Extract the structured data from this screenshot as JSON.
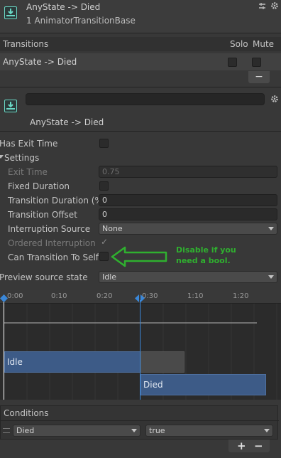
{
  "header": {
    "title": "AnyState -> Died",
    "subtitle": "1 AnimatorTransitionBase"
  },
  "transitions": {
    "heading": "Transitions",
    "solo_label": "Solo",
    "mute_label": "Mute",
    "row_label": "AnyState -> Died",
    "remove_label": "−"
  },
  "transition_inspector": {
    "name_field": "",
    "title": "AnyState -> Died",
    "has_exit_time_label": "Has Exit Time",
    "settings_label": "Settings",
    "exit_time_label": "Exit Time",
    "exit_time_value": "0.75",
    "fixed_duration_label": "Fixed Duration",
    "transition_duration_label": "Transition Duration (%)",
    "transition_duration_value": "0",
    "transition_offset_label": "Transition Offset",
    "transition_offset_value": "0",
    "interruption_source_label": "Interruption Source",
    "interruption_source_value": "None",
    "ordered_interruption_label": "Ordered Interruption",
    "ordered_interruption_check": "✓",
    "can_transition_label": "Can Transition To Self",
    "annotation_line1": "Disable if you",
    "annotation_line2": "need a bool.",
    "preview_label": "Preview source state",
    "preview_value": "Idle"
  },
  "timeline": {
    "ticks": [
      "0:00",
      "0:10",
      "0:20",
      "0:30",
      "1:10",
      "1:20"
    ],
    "bar_idle": "Idle",
    "bar_died": "Died"
  },
  "conditions": {
    "heading": "Conditions",
    "param": "Died",
    "value": "true",
    "add_label": "+",
    "remove_label": "−"
  },
  "colors": {
    "annotation_green": "#2fb02f",
    "bar_blue": "#3d5b87",
    "accent_blue": "#3a87d8"
  }
}
